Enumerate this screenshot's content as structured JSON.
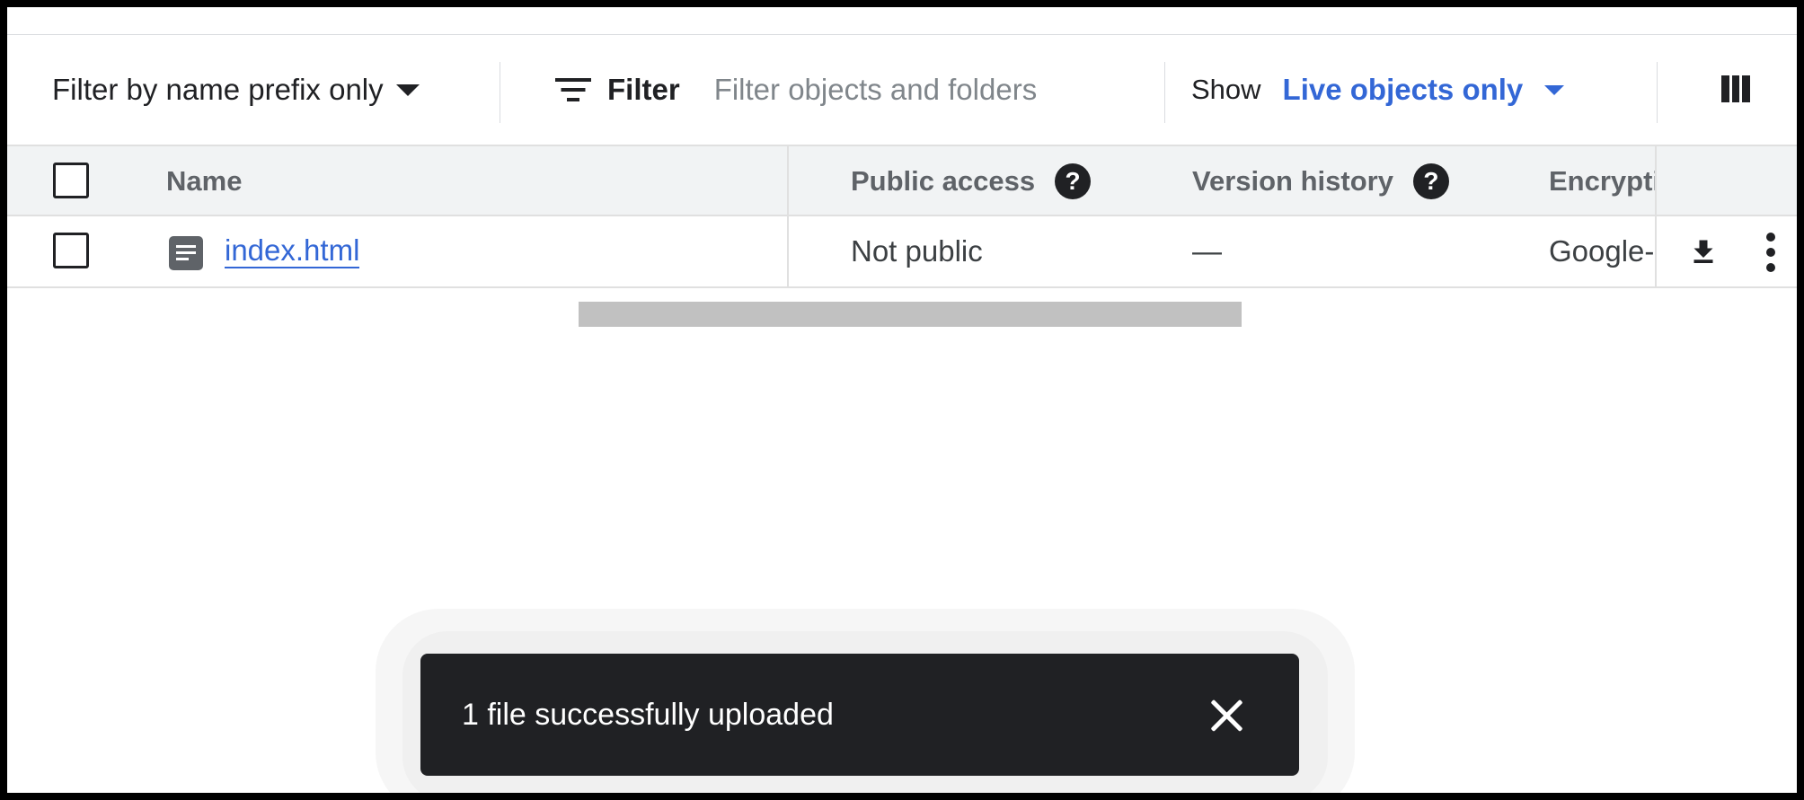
{
  "toolbar": {
    "prefix_filter_label": "Filter by name prefix only",
    "filter_label": "Filter",
    "filter_placeholder": "Filter objects and folders",
    "show_label": "Show",
    "show_value": "Live objects only"
  },
  "table": {
    "headers": {
      "name": "Name",
      "public_access": "Public access",
      "version_history": "Version history",
      "encryption": "Encryption"
    },
    "rows": [
      {
        "name": "index.html",
        "public_access": "Not public",
        "version_history": "—",
        "encryption": "Google-managed key"
      }
    ]
  },
  "snackbar": {
    "message": "1 file successfully uploaded"
  },
  "icons": [
    "chevron-down-icon",
    "filter-icon",
    "columns-icon",
    "help-icon",
    "file-icon",
    "download-icon",
    "more-vert-icon",
    "close-icon"
  ],
  "colors": {
    "link": "#3367d6",
    "snackbar_bg": "#202124",
    "header_bg": "#f1f3f4"
  }
}
